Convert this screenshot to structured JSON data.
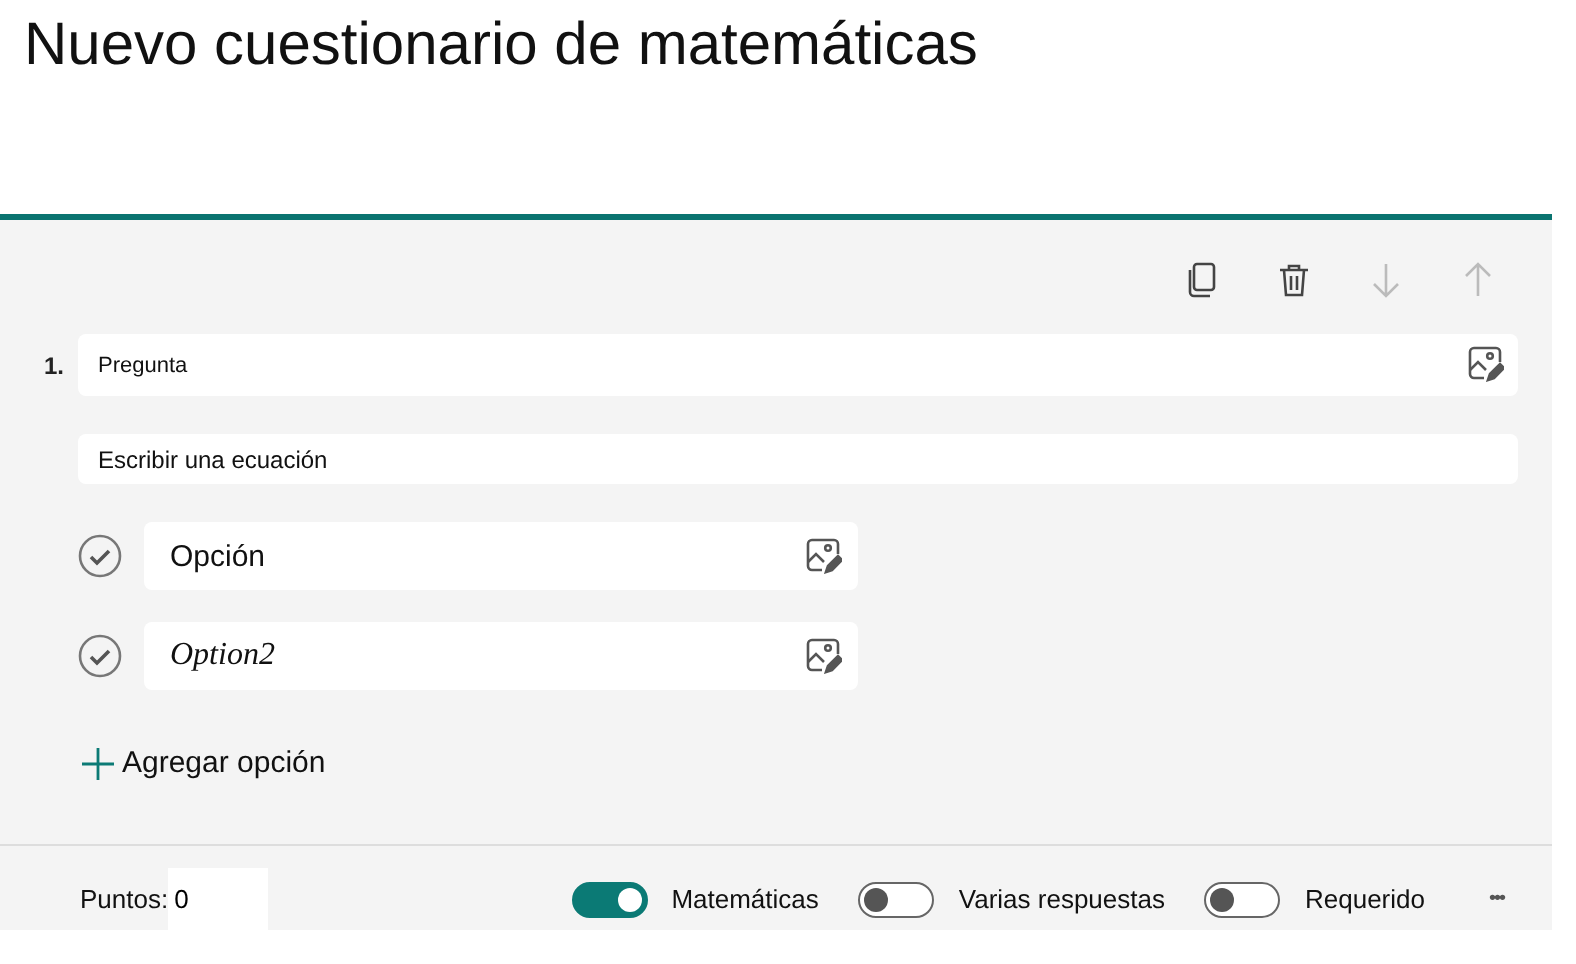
{
  "title": "Nuevo cuestionario de matemáticas",
  "toolbar": [
    {
      "kind": "copy",
      "disabled": false
    },
    {
      "kind": "delete",
      "disabled": false
    },
    {
      "kind": "down",
      "disabled": true
    },
    {
      "kind": "up",
      "disabled": true
    }
  ],
  "question": {
    "number": "1.",
    "placeholder": "Pregunta",
    "equation_placeholder": "Escribir una ecuación"
  },
  "options": [
    {
      "kind": "text",
      "value": "Opción"
    },
    {
      "kind": "math",
      "value": "Option2"
    }
  ],
  "add_option": "Agregar opción",
  "footer": {
    "points_label": "Puntos:",
    "points_value": "0",
    "toggles": [
      {
        "label": "Matemáticas",
        "on": true
      },
      {
        "label": "Varias respuestas",
        "on": false
      },
      {
        "label": "Requerido",
        "on": false
      }
    ],
    "more": "•••"
  }
}
